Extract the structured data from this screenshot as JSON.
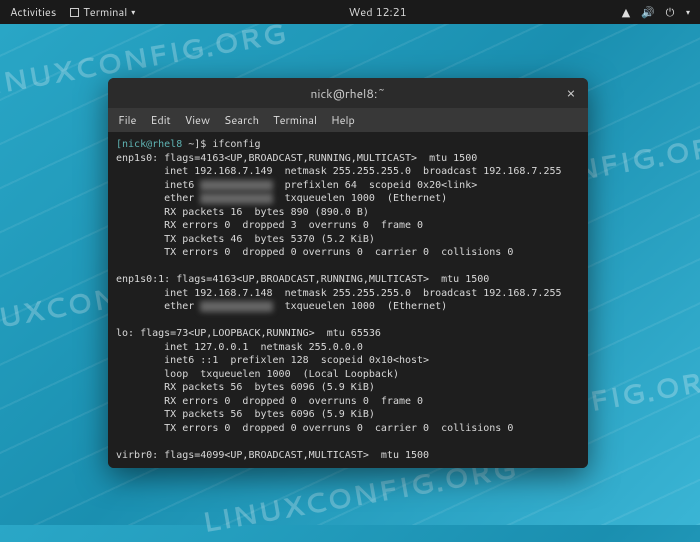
{
  "topbar": {
    "activities": "Activities",
    "terminal_label": "Terminal",
    "clock": "Wed 12:21"
  },
  "watermark": "LINUXCONFIG.ORG",
  "window": {
    "title": "nick@rhel8:~",
    "close": "×"
  },
  "menubar": {
    "file": "File",
    "edit": "Edit",
    "view": "View",
    "search": "Search",
    "terminal": "Terminal",
    "help": "Help"
  },
  "terminal": {
    "prompt_user": "[nick@rhel8",
    "prompt_path": "~]$",
    "command": "ifconfig",
    "output": [
      "enp1s0: flags=4163<UP,BROADCAST,RUNNING,MULTICAST>  mtu 1500",
      "        inet 192.168.7.149  netmask 255.255.255.0  broadcast 192.168.7.255",
      "        inet6 ████████████████████  prefixlen 64  scopeid 0x20<link>",
      "        ether ██████████████  txqueuelen 1000  (Ethernet)",
      "        RX packets 16  bytes 890 (890.0 B)",
      "        RX errors 0  dropped 3  overruns 0  frame 0",
      "        TX packets 46  bytes 5370 (5.2 KiB)",
      "        TX errors 0  dropped 0 overruns 0  carrier 0  collisions 0",
      "",
      "enp1s0:1: flags=4163<UP,BROADCAST,RUNNING,MULTICAST>  mtu 1500",
      "        inet 192.168.7.148  netmask 255.255.255.0  broadcast 192.168.7.255",
      "        ether ██████████████  txqueuelen 1000  (Ethernet)",
      "",
      "lo: flags=73<UP,LOOPBACK,RUNNING>  mtu 65536",
      "        inet 127.0.0.1  netmask 255.0.0.0",
      "        inet6 ::1  prefixlen 128  scopeid 0x10<host>",
      "        loop  txqueuelen 1000  (Local Loopback)",
      "        RX packets 56  bytes 6096 (5.9 KiB)",
      "        RX errors 0  dropped 0  overruns 0  frame 0",
      "        TX packets 56  bytes 6096 (5.9 KiB)",
      "        TX errors 0  dropped 0 overruns 0  carrier 0  collisions 0",
      "",
      "virbr0: flags=4099<UP,BROADCAST,MULTICAST>  mtu 1500"
    ]
  }
}
